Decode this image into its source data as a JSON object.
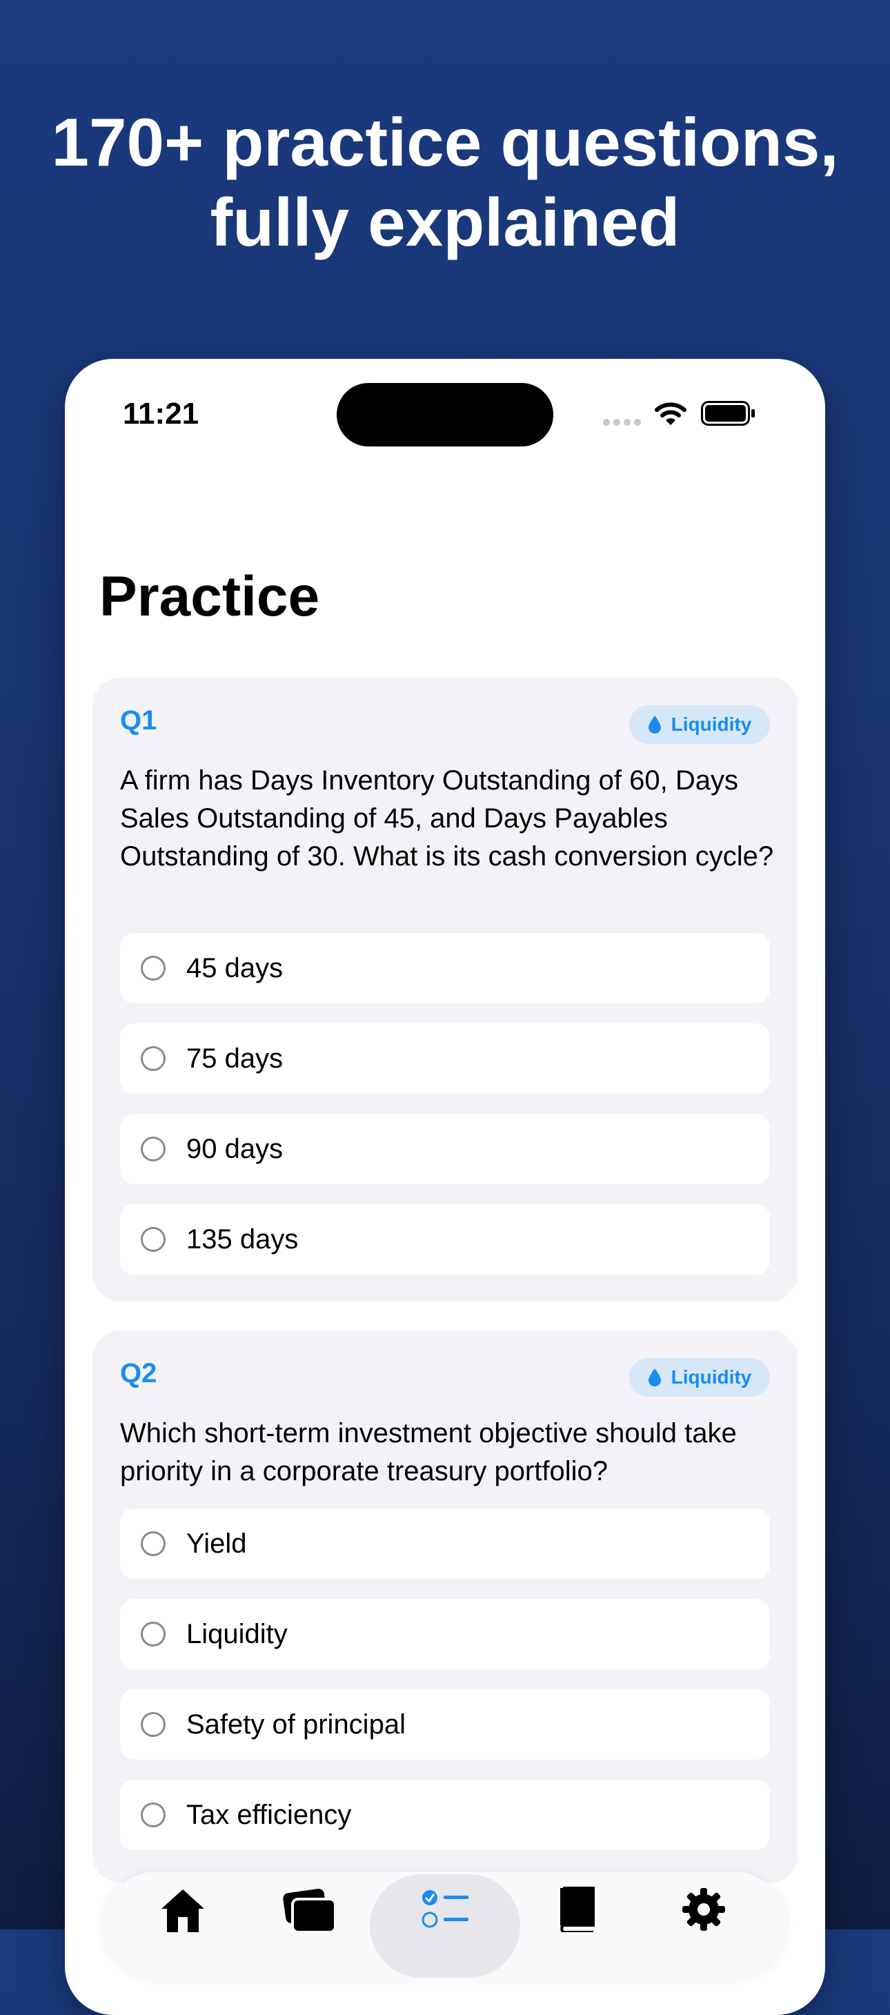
{
  "headline": {
    "line1": "170+ practice questions,",
    "line2": "fully explained"
  },
  "status_bar": {
    "time": "11:21"
  },
  "page": {
    "title": "Practice"
  },
  "questions": [
    {
      "number": "Q1",
      "topic": "Liquidity",
      "text": "A firm has Days Inventory Outstanding of 60, Days Sales Outstanding of 45, and Days Payables Outstanding of 30. What is its cash conversion cycle?",
      "options": [
        "45 days",
        "75 days",
        "90 days",
        "135 days"
      ]
    },
    {
      "number": "Q2",
      "topic": "Liquidity",
      "text": "Which short-term investment objective should take priority in a corporate treasury portfolio?",
      "options": [
        "Yield",
        "Liquidity",
        "Safety of principal",
        "Tax efficiency"
      ]
    }
  ],
  "tab_bar": {
    "tabs": [
      {
        "icon": "house-icon",
        "active": false
      },
      {
        "icon": "cards-icon",
        "active": false
      },
      {
        "icon": "checklist-icon",
        "active": true
      },
      {
        "icon": "book-icon",
        "active": false
      },
      {
        "icon": "gear-icon",
        "active": false
      }
    ]
  },
  "colors": {
    "accent": "#1a8cf0",
    "background_top": "#1a3a7e",
    "background_bottom": "#101d40",
    "card": "#f2f2f7",
    "badge": "#d6e7f8"
  }
}
